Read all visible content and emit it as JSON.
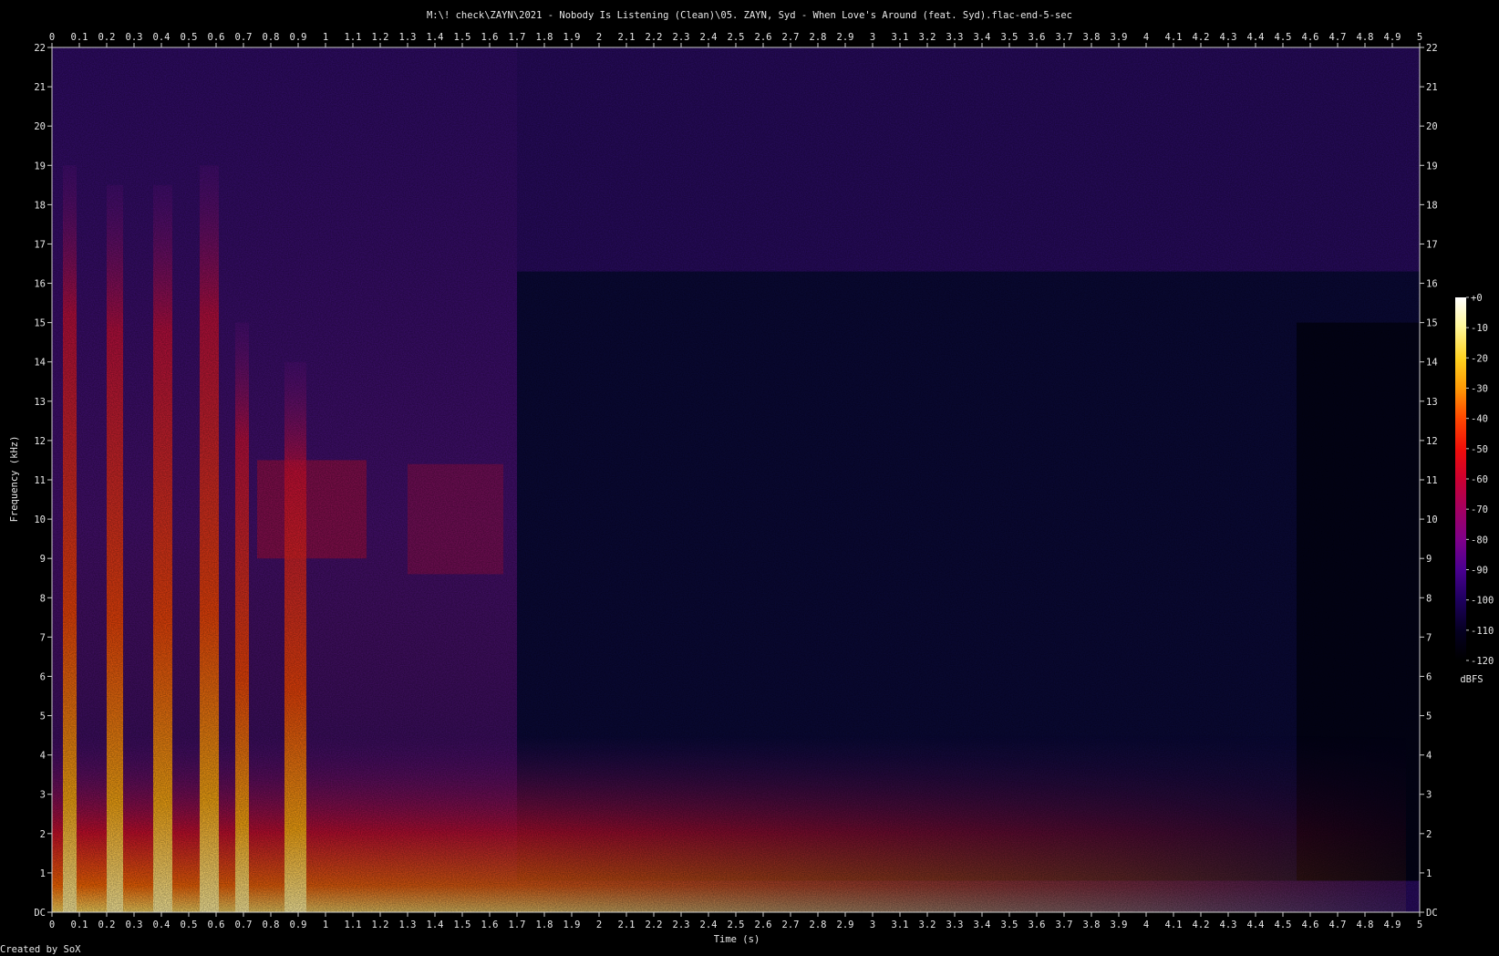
{
  "chart_data": {
    "type": "heatmap",
    "title": "M:\\! check\\ZAYN\\2021 - Nobody Is Listening (Clean)\\05. ZAYN, Syd - When Love's Around (feat. Syd).flac-end-5-sec",
    "xlabel": "Time (s)",
    "ylabel": "Frequency (kHz)",
    "xlim": [
      0,
      5
    ],
    "ylim": [
      0,
      22
    ],
    "x_ticks": [
      "0",
      "0.1",
      "0.2",
      "0.3",
      "0.4",
      "0.5",
      "0.6",
      "0.7",
      "0.8",
      "0.9",
      "1",
      "1.1",
      "1.2",
      "1.3",
      "1.4",
      "1.5",
      "1.6",
      "1.7",
      "1.8",
      "1.9",
      "2",
      "2.1",
      "2.2",
      "2.3",
      "2.4",
      "2.5",
      "2.6",
      "2.7",
      "2.8",
      "2.9",
      "3",
      "3.1",
      "3.2",
      "3.3",
      "3.4",
      "3.5",
      "3.6",
      "3.7",
      "3.8",
      "3.9",
      "4",
      "4.1",
      "4.2",
      "4.3",
      "4.4",
      "4.5",
      "4.6",
      "4.7",
      "4.8",
      "4.9",
      "5"
    ],
    "y_ticks": [
      "DC",
      "1",
      "2",
      "3",
      "4",
      "5",
      "6",
      "7",
      "8",
      "9",
      "10",
      "11",
      "12",
      "13",
      "14",
      "15",
      "16",
      "17",
      "18",
      "19",
      "20",
      "21",
      "22"
    ],
    "colorbar": {
      "unit": "dBFS",
      "range": [
        -120,
        0
      ],
      "ticks": [
        "+0",
        "-10",
        "-20",
        "-30",
        "-40",
        "-50",
        "-60",
        "-70",
        "-80",
        "-90",
        "-100",
        "-110",
        "-120"
      ],
      "colors": [
        "#ffffff",
        "#fff79a",
        "#ffd11f",
        "#ff9a06",
        "#ff4a00",
        "#ef0d0a",
        "#cc0030",
        "#a5005f",
        "#7d008a",
        "#4a0090",
        "#1f0060",
        "#050020",
        "#000000"
      ]
    },
    "footer": "Created by SoX"
  }
}
